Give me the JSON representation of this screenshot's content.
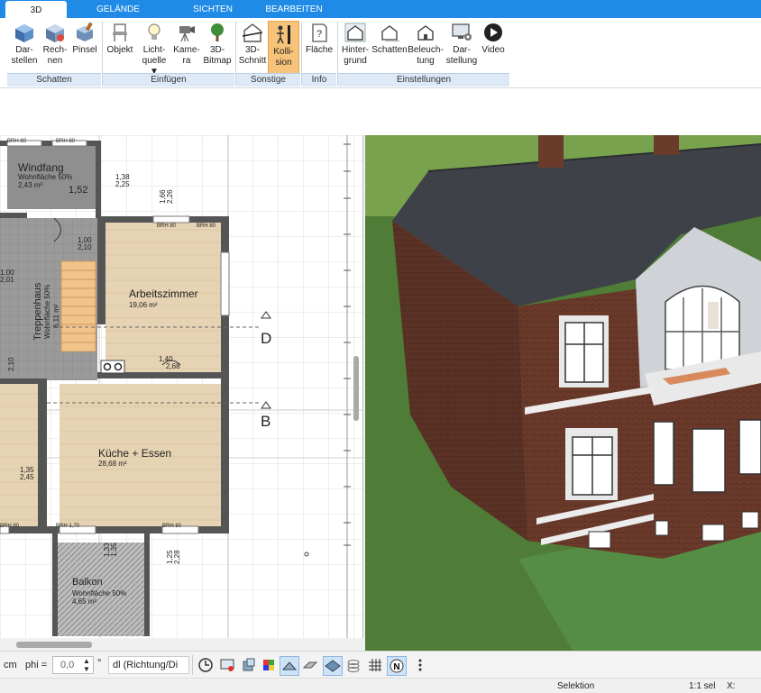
{
  "tabs": [
    {
      "label": "3D",
      "active": true
    },
    {
      "label": "GELÄNDE",
      "active": false
    },
    {
      "label": "SICHTEN",
      "active": false
    },
    {
      "label": "BEARBEITEN",
      "active": false
    }
  ],
  "ribbon": {
    "buttons": [
      {
        "id": "darstellen",
        "line1": "Dar-",
        "line2": "stellen",
        "icon": "cube-display-icon"
      },
      {
        "id": "rechnen",
        "line1": "Rech-",
        "line2": "nen",
        "icon": "cube-compute-icon"
      },
      {
        "id": "pinsel",
        "line1": "Pinsel",
        "line2": "",
        "icon": "brush-cube-icon"
      },
      {
        "id": "objekt",
        "line1": "Objekt",
        "line2": "",
        "icon": "chair-icon"
      },
      {
        "id": "lichtquelle",
        "line1": "Licht-",
        "line2": "quelle ▼",
        "icon": "lightbulb-icon"
      },
      {
        "id": "kamera",
        "line1": "Kame-",
        "line2": "ra",
        "icon": "camera-icon"
      },
      {
        "id": "bitmap",
        "line1": "3D-",
        "line2": "Bitmap",
        "icon": "tree-icon"
      },
      {
        "id": "schnitt",
        "line1": "3D-",
        "line2": "Schnitt",
        "icon": "section-house-icon"
      },
      {
        "id": "kollision",
        "line1": "Kolli-",
        "line2": "sion",
        "icon": "collision-icon"
      },
      {
        "id": "flaeche",
        "line1": "Fläche",
        "line2": "",
        "icon": "area-info-icon"
      },
      {
        "id": "hintergrund",
        "line1": "Hinter-",
        "line2": "grund",
        "icon": "house-background-icon"
      },
      {
        "id": "schatten2",
        "line1": "Schatten",
        "line2": "",
        "icon": "house-shadow-icon"
      },
      {
        "id": "beleuchtung",
        "line1": "Beleuch-",
        "line2": "tung",
        "icon": "house-light-icon"
      },
      {
        "id": "darstellung",
        "line1": "Dar-",
        "line2": "stellung",
        "icon": "monitor-gear-icon"
      },
      {
        "id": "video",
        "line1": "Video",
        "line2": "",
        "icon": "play-icon"
      }
    ],
    "groups": [
      {
        "id": "schatten",
        "label": "Schatten"
      },
      {
        "id": "einfuegen",
        "label": "Einfügen"
      },
      {
        "id": "sonstige",
        "label": "Sonstige"
      },
      {
        "id": "info",
        "label": "Info"
      },
      {
        "id": "einstellungen",
        "label": "Einstellungen"
      }
    ]
  },
  "plan": {
    "rooms": [
      {
        "name": "Windfang",
        "sub": "Wohnfläche 50%",
        "area": "2,43 m²"
      },
      {
        "name": "Arbeitszimmer",
        "sub": "",
        "area": "19,06 m²"
      },
      {
        "name": "Treppenhaus",
        "sub": "Wohnfläche 50%",
        "area": "6,11 m²"
      },
      {
        "name": "Küche + Essen",
        "sub": "",
        "area": "28,68 m²"
      },
      {
        "name": "Balkon",
        "sub": "Wohnfläche 50%",
        "area": "4,65 m²"
      }
    ],
    "dims": [
      "1,52",
      "1,38",
      "2,25",
      "1,66",
      "2,26",
      "1,00",
      "2,10",
      "1,00",
      "2,01",
      "1,40",
      "2,68",
      "1,35",
      "2,45",
      "1,25",
      "2,28",
      "1,33",
      "1,35",
      "2,10"
    ],
    "brh": [
      "BRH 80",
      "BRH 80",
      "BRH 80",
      "BRH 80",
      "BRH 1,70",
      "BRH 80",
      "BRH 80"
    ],
    "sections": [
      "D",
      "B"
    ]
  },
  "bottom": {
    "unit": "cm",
    "phi_label": "phi =",
    "phi_value": "0,0",
    "degree": "°",
    "mode_value": "dl (Richtung/Di"
  },
  "status": {
    "mode": "Selektion",
    "scale": "1:1 sel",
    "x_label": "X:"
  }
}
